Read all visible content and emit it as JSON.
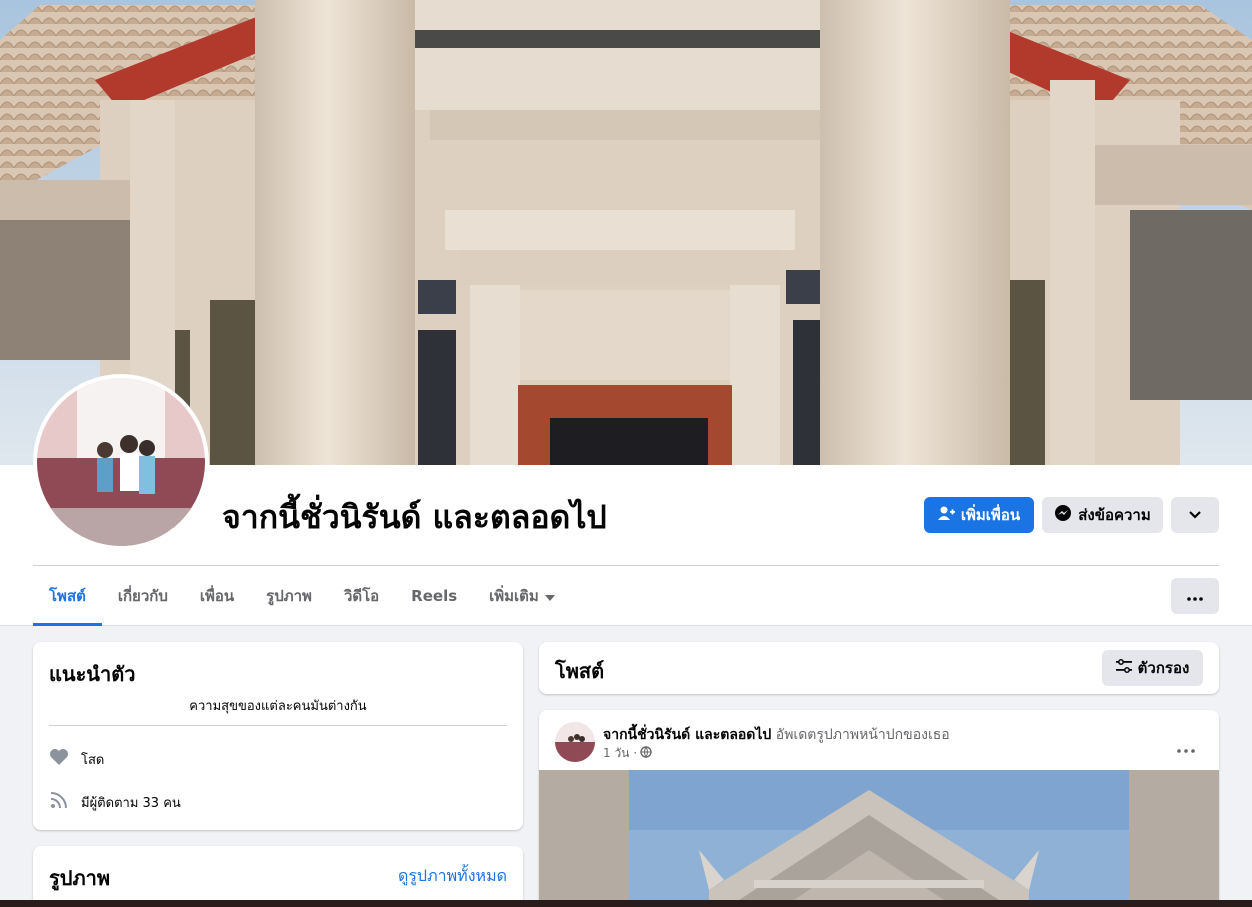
{
  "profile": {
    "name": "จากนี้ชั่วนิรันด์ และตลอดไป"
  },
  "actions": {
    "add_friend": "เพิ่มเพื่อน",
    "message": "ส่งข้อความ",
    "add_friend_icon": "person-add-icon",
    "message_icon": "messenger-icon",
    "dropdown_icon": "chevron-down-icon"
  },
  "tabs": [
    {
      "label": "โพสต์",
      "active": true
    },
    {
      "label": "เกี่ยวกับ"
    },
    {
      "label": "เพื่อน"
    },
    {
      "label": "รูปภาพ"
    },
    {
      "label": "วิดีโอ"
    },
    {
      "label": "Reels"
    },
    {
      "label": "เพิ่มเติม"
    }
  ],
  "intro": {
    "title": "แนะนำตัว",
    "bio": "ความสุขของแต่ละคนมันต่างกัน",
    "relationship": "โสด",
    "followers": "มีผู้ติดตาม 33 คน"
  },
  "photos": {
    "title": "รูปภาพ",
    "see_all": "ดูรูปภาพทั้งหมด"
  },
  "posts_header": {
    "title": "โพสต์",
    "filter": "ตัวกรอง"
  },
  "post": {
    "author": "จากนี้ชั่วนิรันด์ และตลอดไป",
    "action": "อัพเดตรูปภาพหน้าปกของเธอ",
    "time": "1 วัน ·",
    "privacy_icon": "globe-icon"
  },
  "colors": {
    "accent": "#1b74e4",
    "page_bg": "#f0f2f5"
  }
}
